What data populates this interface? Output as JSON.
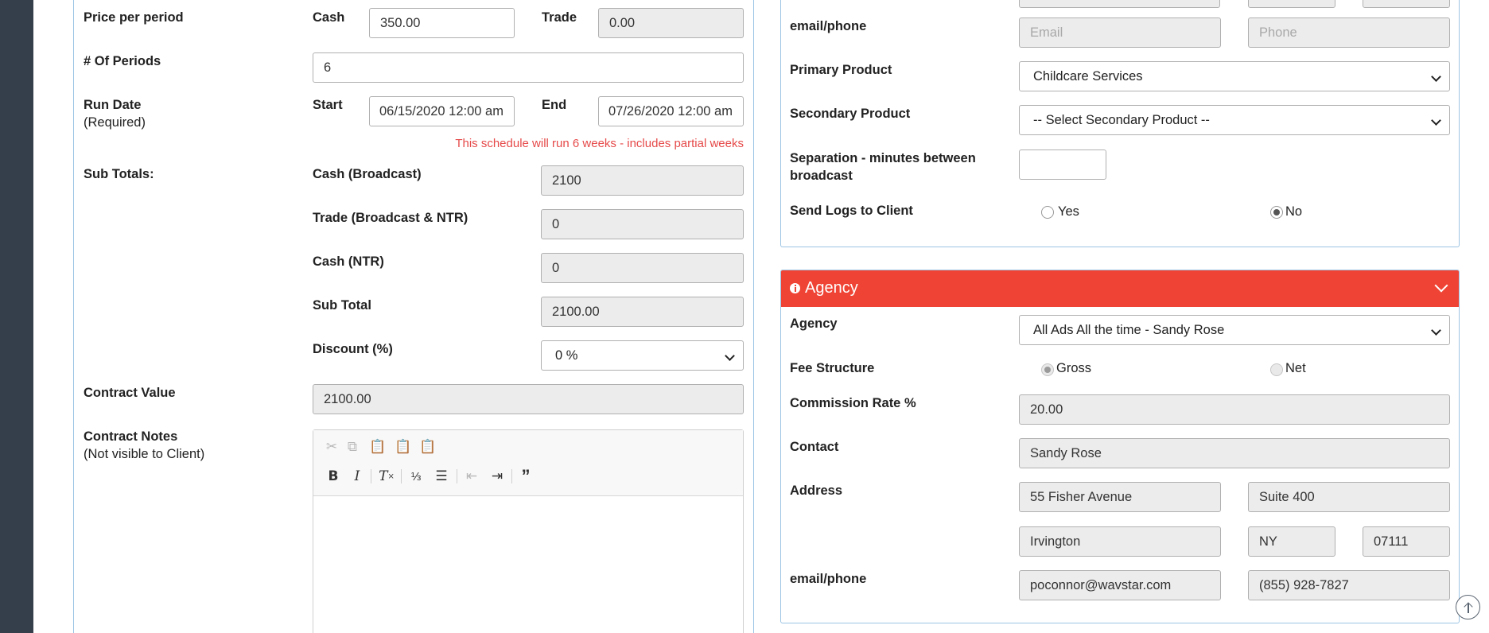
{
  "left": {
    "price": {
      "label": "Price per period",
      "cash_label": "Cash",
      "cash_value": "350.00",
      "trade_label": "Trade",
      "trade_value": "0.00"
    },
    "periods": {
      "label": "# Of Periods",
      "value": "6"
    },
    "run_date": {
      "label": "Run Date",
      "sublabel": "(Required)",
      "start_label": "Start",
      "start_value": "06/15/2020 12:00 am",
      "end_label": "End",
      "end_value": "07/26/2020 12:00 am",
      "warning": "This schedule will run 6 weeks - includes partial weeks"
    },
    "subtotals": {
      "label": "Sub Totals:",
      "cash_broadcast_label": "Cash (Broadcast)",
      "cash_broadcast_value": "2100",
      "trade_label": "Trade (Broadcast & NTR)",
      "trade_value": "0",
      "cash_ntr_label": "Cash (NTR)",
      "cash_ntr_value": "0",
      "subtotal_label": "Sub Total",
      "subtotal_value": "2100.00",
      "discount_label": "Discount (%)",
      "discount_value": "0 %"
    },
    "contract_value": {
      "label": "Contract Value",
      "value": "2100.00"
    },
    "contract_notes": {
      "label": "Contract Notes",
      "sublabel": "(Not visible to Client)"
    }
  },
  "right_top": {
    "email_phone_label": "email/phone",
    "email_placeholder": "Email",
    "phone_placeholder": "Phone",
    "primary_product": {
      "label": "Primary Product",
      "value": "Childcare Services"
    },
    "secondary_product": {
      "label": "Secondary Product",
      "value": "-- Select Secondary Product --"
    },
    "separation": {
      "label_line1": "Separation - minutes between",
      "label_line2": "broadcast",
      "value": ""
    },
    "send_logs": {
      "label": "Send Logs to Client",
      "yes_label": "Yes",
      "no_label": "No",
      "selected": "No"
    }
  },
  "agency": {
    "title": "Agency",
    "agency_label": "Agency",
    "agency_value": "All Ads All the time - Sandy Rose",
    "fee_label": "Fee Structure",
    "gross_label": "Gross",
    "net_label": "Net",
    "fee_selected": "Gross",
    "commission_label": "Commission Rate %",
    "commission_value": "20.00",
    "contact_label": "Contact",
    "contact_value": "Sandy Rose",
    "address_label": "Address",
    "address1": "55 Fisher Avenue",
    "address2": "Suite 400",
    "city": "Irvington",
    "state": "NY",
    "zip": "07111",
    "email_phone_label": "email/phone",
    "email": "poconnor@wavstar.com",
    "phone": "(855) 928-7827"
  },
  "colors": {
    "sidebar": "#353f4c",
    "agency_header": "#ef4435",
    "warning": "#e64949",
    "panel_border": "#9cc4e4"
  },
  "icons": [
    "cut-icon",
    "copy-icon",
    "paste-icon",
    "paste-text-icon",
    "paste-word-icon",
    "bold-icon",
    "italic-icon",
    "remove-format-icon",
    "numbered-list-icon",
    "bulleted-list-icon",
    "outdent-icon",
    "indent-icon",
    "blockquote-icon",
    "info-icon",
    "collapse-icon",
    "scroll-top-icon"
  ]
}
